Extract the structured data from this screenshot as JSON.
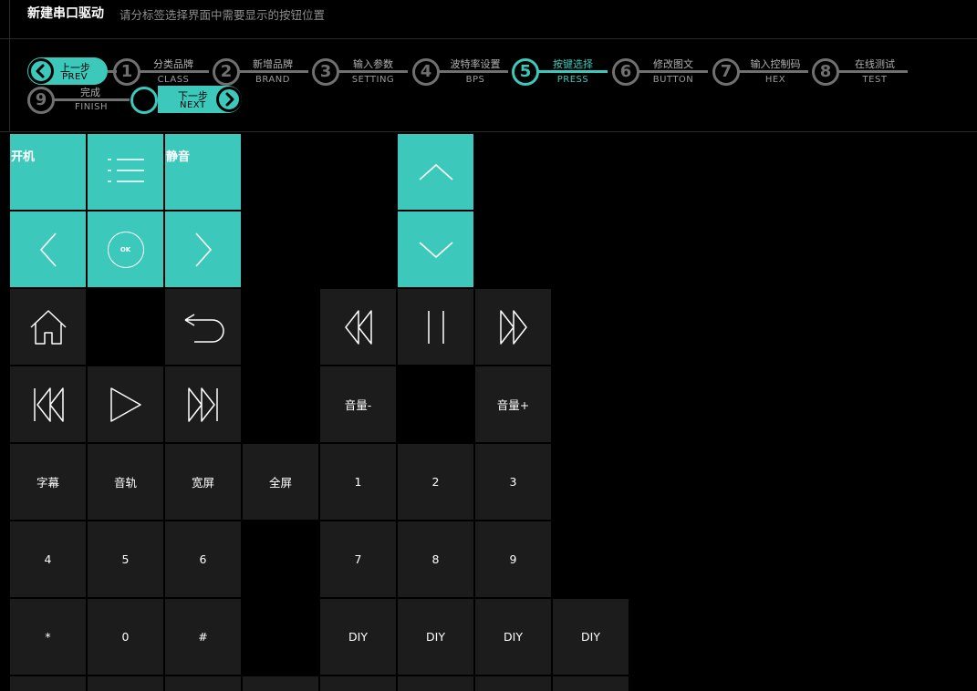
{
  "header": {
    "title": "新建串口驱动",
    "subtitle": "请分标签选择界面中需要显示的按钮位置"
  },
  "nav": {
    "prev": {
      "cn": "上一步",
      "en": "PREV",
      "icon": "chevron-left-icon"
    },
    "next": {
      "cn": "下一步",
      "en": "NEXT",
      "icon": "chevron-right-icon"
    }
  },
  "steps": [
    {
      "num": "1",
      "cn": "分类品牌",
      "en": "CLASS",
      "active": false
    },
    {
      "num": "2",
      "cn": "新增品牌",
      "en": "BRAND",
      "active": false
    },
    {
      "num": "3",
      "cn": "输入参数",
      "en": "SETTING",
      "active": false
    },
    {
      "num": "4",
      "cn": "波特率设置",
      "en": "BPS",
      "active": false
    },
    {
      "num": "5",
      "cn": "按键选择",
      "en": "PRESS",
      "active": true
    },
    {
      "num": "6",
      "cn": "修改图文",
      "en": "BUTTON",
      "active": false
    },
    {
      "num": "7",
      "cn": "输入控制码",
      "en": "HEX",
      "active": false
    },
    {
      "num": "8",
      "cn": "在线测试",
      "en": "TEST",
      "active": false
    },
    {
      "num": "9",
      "cn": "完成",
      "en": "FINISH",
      "active": false
    }
  ],
  "buttons": {
    "power": "开机",
    "mute": "静音",
    "ok": "OK",
    "vol_down": "音量-",
    "vol_up": "音量+",
    "subtitle": "字幕",
    "audio_track": "音轨",
    "wide": "宽屏",
    "fullscreen": "全屏",
    "digits": [
      "1",
      "2",
      "3",
      "4",
      "5",
      "6",
      "7",
      "8",
      "9",
      "*",
      "0",
      "#"
    ],
    "diy": "DIY"
  },
  "colors": {
    "accent": "#3cc9bb",
    "button_bg": "#1c1c1c",
    "inactive": "#707070"
  }
}
